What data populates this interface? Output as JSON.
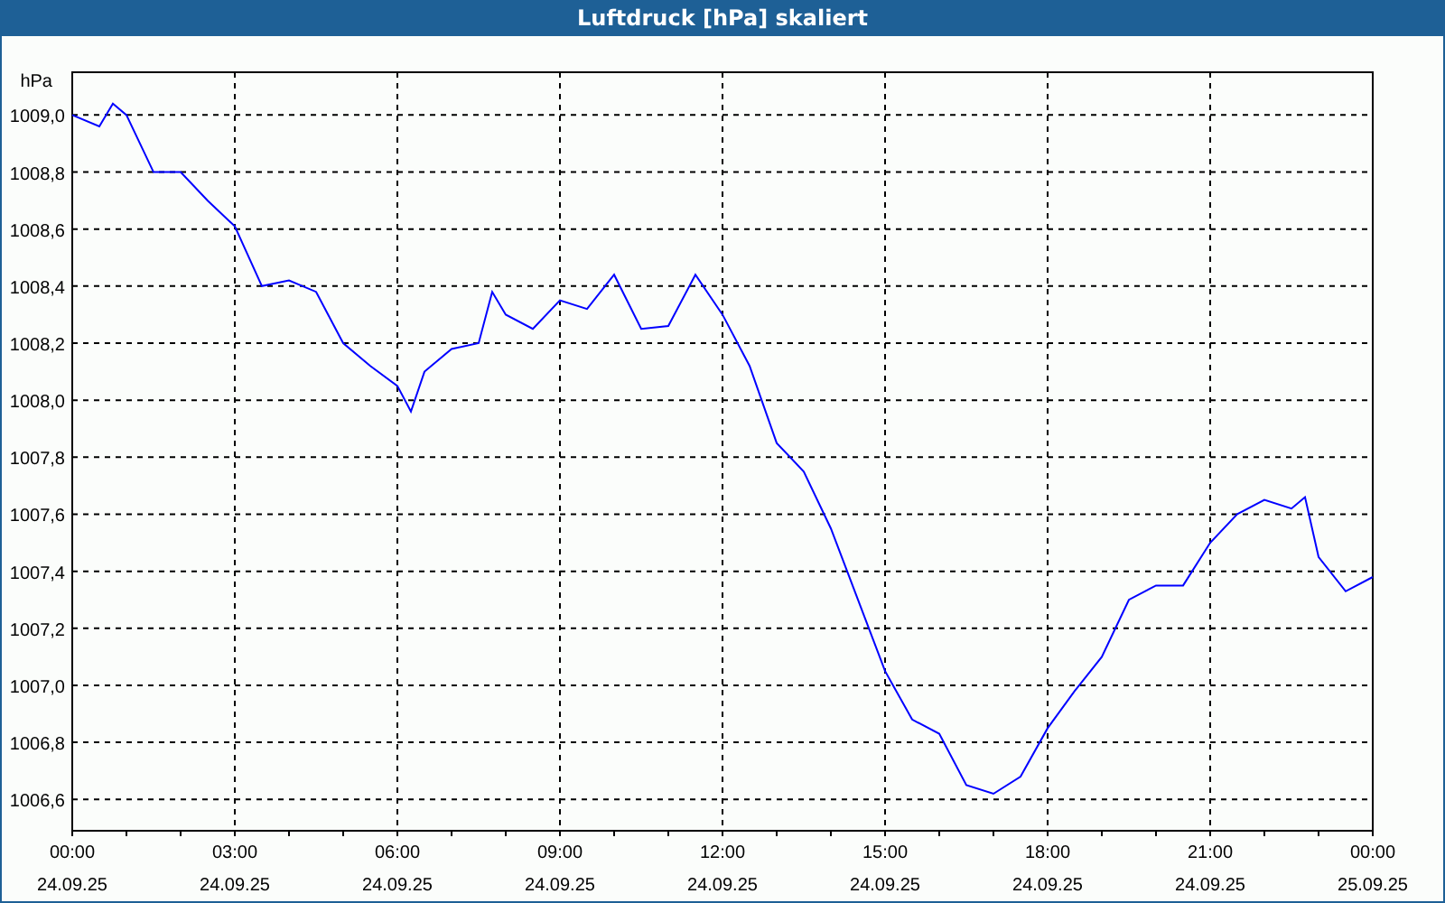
{
  "window": {
    "title": "Luftdruck [hPa] skaliert"
  },
  "chart": {
    "chart_data": {
      "type": "line",
      "ylabel": "hPa",
      "grid": true,
      "series": [
        {
          "color": "#0000ff",
          "values": [
            1009.0,
            1008.96,
            1009.04,
            1009.0,
            1008.8,
            1008.8,
            1008.7,
            1008.61,
            1008.4,
            1008.42,
            1008.38,
            1008.2,
            1008.12,
            1008.05,
            1007.96,
            1008.1,
            1008.18,
            1008.2,
            1008.38,
            1008.3,
            1008.25,
            1008.35,
            1008.32,
            1008.44,
            1008.25,
            1008.26,
            1008.44,
            1008.3,
            1008.12,
            1007.85,
            1007.75,
            1007.55,
            1007.3,
            1007.05,
            1006.88,
            1006.83,
            1006.65,
            1006.62,
            1006.68,
            1006.85,
            1006.98,
            1007.1,
            1007.3,
            1007.35,
            1007.35,
            1007.5,
            1007.6,
            1007.65,
            1007.62,
            1007.66,
            1007.45,
            1007.33,
            1007.38
          ]
        }
      ],
      "x": [
        0,
        0.5,
        0.75,
        1,
        1.5,
        2,
        2.5,
        3,
        3.5,
        4,
        4.5,
        5,
        5.5,
        6,
        6.25,
        6.5,
        7,
        7.5,
        7.75,
        8,
        8.5,
        9,
        9.5,
        10,
        10.5,
        11,
        11.5,
        12,
        12.5,
        13,
        13.5,
        14,
        14.5,
        15,
        15.5,
        16,
        16.5,
        17,
        17.5,
        18,
        18.5,
        19,
        19.5,
        20,
        20.5,
        21,
        21.5,
        22,
        22.5,
        22.75,
        23,
        23.5,
        24
      ],
      "xlim": [
        0,
        24
      ],
      "ylim": [
        1006.49,
        1009.15
      ],
      "xticks": [
        {
          "value": 0,
          "label": "00:00"
        },
        {
          "value": 3,
          "label": "03:00"
        },
        {
          "value": 6,
          "label": "06:00"
        },
        {
          "value": 9,
          "label": "09:00"
        },
        {
          "value": 12,
          "label": "12:00"
        },
        {
          "value": 15,
          "label": "15:00"
        },
        {
          "value": 18,
          "label": "18:00"
        },
        {
          "value": 21,
          "label": "21:00"
        },
        {
          "value": 24,
          "label": "00:00"
        }
      ],
      "yticks": [
        {
          "value": 1006.6,
          "label": "1006,6"
        },
        {
          "value": 1006.8,
          "label": "1006,8"
        },
        {
          "value": 1007.0,
          "label": "1007,0"
        },
        {
          "value": 1007.2,
          "label": "1007,2"
        },
        {
          "value": 1007.4,
          "label": "1007,4"
        },
        {
          "value": 1007.6,
          "label": "1007,6"
        },
        {
          "value": 1007.8,
          "label": "1007,8"
        },
        {
          "value": 1008.0,
          "label": "1008,0"
        },
        {
          "value": 1008.2,
          "label": "1008,2"
        },
        {
          "value": 1008.4,
          "label": "1008,4"
        },
        {
          "value": 1008.6,
          "label": "1008,6"
        },
        {
          "value": 1008.8,
          "label": "1008,8"
        },
        {
          "value": 1009.0,
          "label": "1009,0"
        }
      ]
    },
    "x_tick_dates": [
      "24.09.25",
      "24.09.25",
      "24.09.25",
      "24.09.25",
      "24.09.25",
      "24.09.25",
      "24.09.25",
      "24.09.25",
      "25.09.25"
    ]
  }
}
